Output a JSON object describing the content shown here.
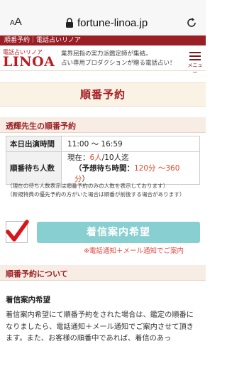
{
  "browser": {
    "aa_small": "A",
    "aa_big": "A",
    "url": "fortune-linoa.jp",
    "icons": {
      "lock": "lock-icon",
      "reload": "reload-icon"
    }
  },
  "header": {
    "breadcrumb": "順番予約｜電話占いリノア",
    "logo_sub": "電話占いリノア",
    "logo_main": "LINOA",
    "tagline_1": "業界屈指の実力派鑑定師が集結。",
    "tagline_2": "占い専用プロダクションが贈る電話占い！",
    "menu_label": "メニュー",
    "brand_color": "#9a1f25"
  },
  "page": {
    "title": "順番予約"
  },
  "reservation": {
    "heading": "透輝先生の順番予約",
    "table": {
      "hours_label": "本日出演時間",
      "hours_value": "11:00 ～ 16:59",
      "queue_label": "順番待ち人数",
      "queue_prefix": "現在：",
      "queue_current": "6人",
      "queue_suffix": "/10人迄",
      "wait_prefix": "（予想待ち時間：",
      "wait_value": "120分 ～360分",
      "wait_suffix": "）"
    },
    "notes": [
      "（現在の待ち人数表示は順番予約のみの人数を表示しております）",
      "（新規特典の優先予約の方がいた場合は順番が前後する場合があります）"
    ],
    "checkbox_checked": true,
    "button_label": "着信案内希望",
    "button_note": "※電話通知＋メール通知でご案内"
  },
  "about": {
    "heading": "順番予約について",
    "subheading": "着信案内希望",
    "paragraph": "着信案内希望にて順番予約をされた場合は、鑑定の順番になりましたら、電話通知＋メール通知でご案内させて頂きます。また、お客様の順番中であれば、着信のあっ"
  }
}
